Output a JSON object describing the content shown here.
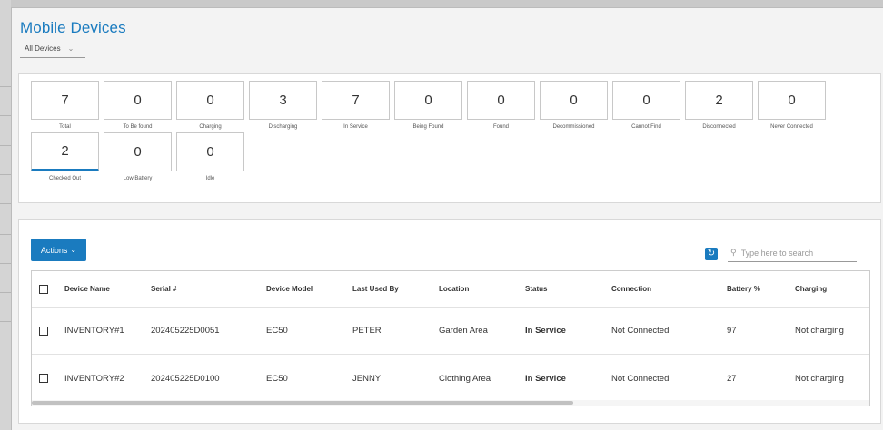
{
  "page": {
    "title": "Mobile Devices",
    "filter_value": "All Devices"
  },
  "stats": [
    {
      "value": "7",
      "label": "Total"
    },
    {
      "value": "0",
      "label": "To Be found"
    },
    {
      "value": "0",
      "label": "Charging"
    },
    {
      "value": "3",
      "label": "Discharging"
    },
    {
      "value": "7",
      "label": "In Service"
    },
    {
      "value": "0",
      "label": "Being Found"
    },
    {
      "value": "0",
      "label": "Found"
    },
    {
      "value": "0",
      "label": "Decommissioned"
    },
    {
      "value": "0",
      "label": "Cannot Find"
    },
    {
      "value": "2",
      "label": "Disconnected"
    },
    {
      "value": "0",
      "label": "Never Connected"
    },
    {
      "value": "2",
      "label": "Checked Out"
    },
    {
      "value": "0",
      "label": "Low Battery"
    },
    {
      "value": "0",
      "label": "Idle"
    }
  ],
  "toolbar": {
    "actions_label": "Actions",
    "refresh_icon": "refresh-icon",
    "search_placeholder": "Type here to search"
  },
  "table": {
    "columns": [
      "Device Name",
      "Serial #",
      "Device Model",
      "Last Used By",
      "Location",
      "Status",
      "Connection",
      "Battery %",
      "Charging"
    ],
    "rows": [
      [
        "INVENTORY#1",
        "202405225D0051",
        "EC50",
        "PETER",
        "Garden Area",
        "In Service",
        "Not Connected",
        "97",
        "Not charging"
      ],
      [
        "INVENTORY#2",
        "202405225D0100",
        "EC50",
        "JENNY",
        "Clothing Area",
        "In Service",
        "Not Connected",
        "27",
        "Not charging"
      ]
    ]
  },
  "colors": {
    "accent": "#1a7bbf",
    "background": "#f3f3f3",
    "panel": "#ffffff"
  }
}
